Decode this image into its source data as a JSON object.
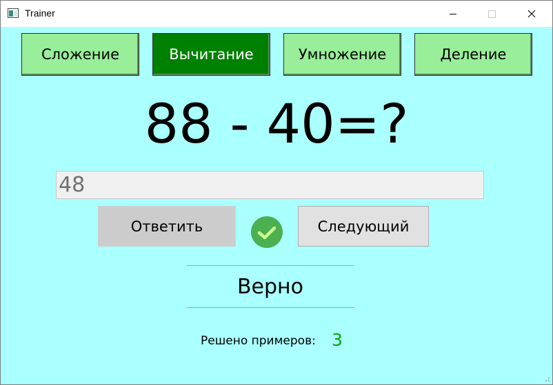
{
  "window": {
    "title": "Trainer"
  },
  "tabs": [
    {
      "label": "Сложение",
      "active": false
    },
    {
      "label": "Вычитание",
      "active": true
    },
    {
      "label": "Умножение",
      "active": false
    },
    {
      "label": "Деление",
      "active": false
    }
  ],
  "question": "88 - 40=?",
  "answer": {
    "value": "48"
  },
  "buttons": {
    "answer_label": "Ответить",
    "next_label": "Следующий"
  },
  "status_icon": "check-icon",
  "result": "Верно",
  "solved": {
    "label": "Решено примеров:",
    "count": "3"
  },
  "colors": {
    "background": "#aaffff",
    "tab_inactive": "#99ee99",
    "tab_active": "#008000",
    "check": "#4caf50",
    "count": "#00aa00"
  }
}
